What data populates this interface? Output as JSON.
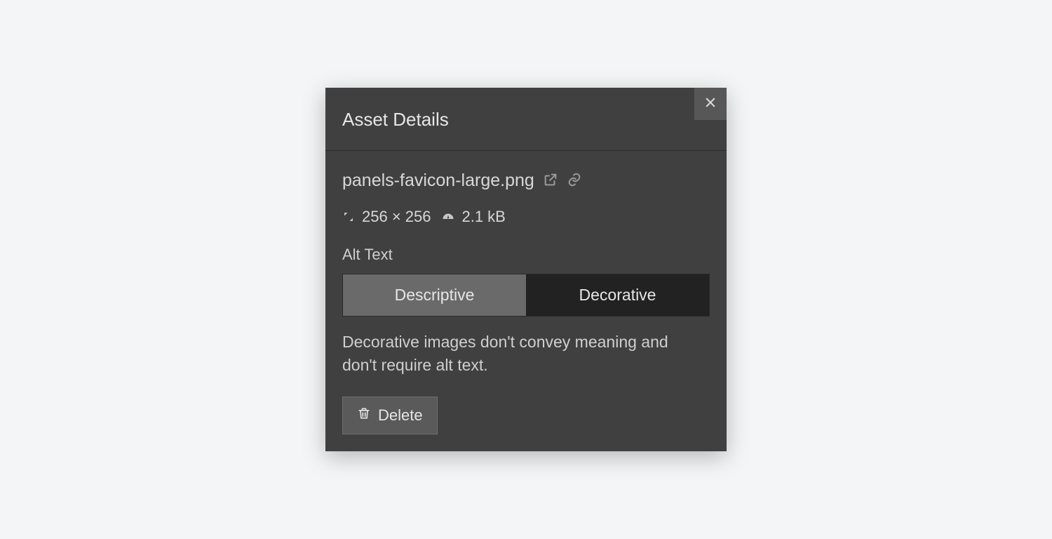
{
  "panel": {
    "title": "Asset Details",
    "filename": "panels-favicon-large.png",
    "dimensions": "256 × 256",
    "filesize": "2.1 kB",
    "alt_text_label": "Alt Text",
    "segmented": {
      "descriptive": "Descriptive",
      "decorative": "Decorative"
    },
    "description": "Decorative images don't convey meaning and don't require alt text.",
    "delete_label": "Delete"
  },
  "icons": {
    "close": "close-icon",
    "external": "external-link-icon",
    "link": "link-icon",
    "dimensions": "dimensions-icon",
    "filesize": "gauge-icon",
    "trash": "trash-icon"
  }
}
